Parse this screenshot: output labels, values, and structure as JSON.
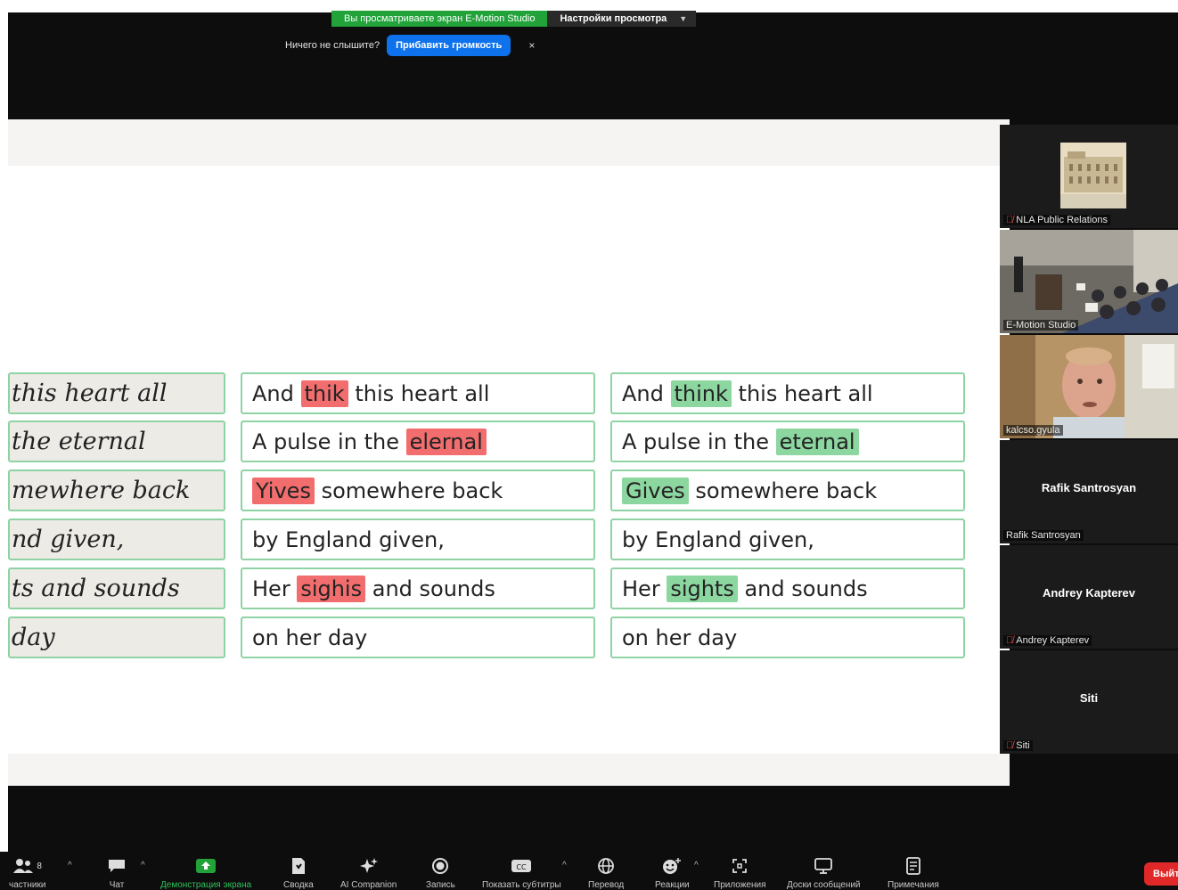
{
  "banner": {
    "share_status": "Вы просматриваете экран E-Motion Studio",
    "view_options": "Настройки просмотра",
    "audio_prompt": "Ничего не слышите?",
    "volume_button": "Прибавить громкость",
    "close": "×"
  },
  "slide": {
    "handwritten": [
      "this heart all",
      "the eternal",
      "mewhere back",
      "nd given,",
      "ts and sounds",
      "day"
    ],
    "errors": [
      {
        "before": "And ",
        "highlight": "thik",
        "after": " this heart all"
      },
      {
        "before": "A pulse in the ",
        "highlight": "elernal",
        "after": ""
      },
      {
        "before": "",
        "highlight": "Yives",
        "after": " somewhere back"
      },
      {
        "before": "by England given,",
        "highlight": "",
        "after": ""
      },
      {
        "before": "Her ",
        "highlight": "sighis",
        "after": " and sounds"
      },
      {
        "before": "on her day",
        "highlight": "",
        "after": ""
      }
    ],
    "corrections": [
      {
        "before": "And ",
        "highlight": "think",
        "after": " this heart all"
      },
      {
        "before": "A pulse in the ",
        "highlight": "eternal",
        "after": ""
      },
      {
        "before": "",
        "highlight": "Gives",
        "after": " somewhere back"
      },
      {
        "before": "by England given,",
        "highlight": "",
        "after": ""
      },
      {
        "before": "Her ",
        "highlight": "sights",
        "after": " and sounds"
      },
      {
        "before": "on her day",
        "highlight": "",
        "after": ""
      }
    ],
    "colors": {
      "error": "#f26d6d",
      "correction": "#8cd6a0",
      "border": "#8fd3a4"
    }
  },
  "participants": [
    {
      "name": "NLA Public Relations",
      "muted": true,
      "video": "building-photo"
    },
    {
      "name": "E-Motion Studio",
      "muted": false,
      "video": "auditorium"
    },
    {
      "name": "kalcso.gyula",
      "muted": false,
      "video": "webcam"
    },
    {
      "name": "Rafik Santrosyan",
      "display": "Rafik Santrosyan",
      "muted": false,
      "video": "none"
    },
    {
      "name": "Andrey Kapterev",
      "display": "Andrey Kapterev",
      "muted": true,
      "video": "none"
    },
    {
      "name": "Siti",
      "display": "Siti",
      "muted": true,
      "video": "none"
    }
  ],
  "toolbar": {
    "participants_count": "8",
    "participants": "частники",
    "chat": "Чат",
    "share": "Демонстрация экрана",
    "summary": "Сводка",
    "ai": "AI Companion",
    "record": "Запись",
    "captions": "Показать субтитры",
    "translate": "Перевод",
    "reactions": "Реакции",
    "apps": "Приложения",
    "whiteboards": "Доски сообщений",
    "notes": "Примечания",
    "leave": "Выйт"
  }
}
